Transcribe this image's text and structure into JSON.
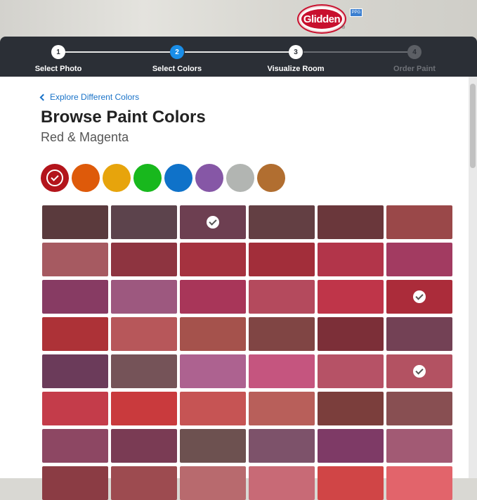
{
  "brand": {
    "logo_text": "Glidden",
    "badge": "PPG"
  },
  "steps": [
    {
      "number": "1",
      "label": "Select Photo",
      "state": "done"
    },
    {
      "number": "2",
      "label": "Select Colors",
      "state": "active"
    },
    {
      "number": "3",
      "label": "Visualize Room",
      "state": "done"
    },
    {
      "number": "4",
      "label": "Order Paint",
      "state": "disabled"
    }
  ],
  "main": {
    "back_link": "Explore Different Colors",
    "title": "Browse Paint Colors",
    "subtitle": "Red & Magenta"
  },
  "color_families": [
    {
      "name": "red",
      "color": "#b3141b",
      "selected": true
    },
    {
      "name": "orange",
      "color": "#de5a0a",
      "selected": false
    },
    {
      "name": "yellow",
      "color": "#e7a40c",
      "selected": false
    },
    {
      "name": "green",
      "color": "#18b81d",
      "selected": false
    },
    {
      "name": "blue",
      "color": "#0f72c9",
      "selected": false
    },
    {
      "name": "purple",
      "color": "#8657a6",
      "selected": false
    },
    {
      "name": "gray",
      "color": "#b2b5b2",
      "selected": false
    },
    {
      "name": "brown",
      "color": "#b16e30",
      "selected": false
    }
  ],
  "swatches": [
    {
      "color": "#5a3a3d",
      "selected": false
    },
    {
      "color": "#5c434c",
      "selected": false
    },
    {
      "color": "#6d3f51",
      "selected": true
    },
    {
      "color": "#633f43",
      "selected": false
    },
    {
      "color": "#6a373b",
      "selected": false
    },
    {
      "color": "#9a4849",
      "selected": false
    },
    {
      "color": "#a65a61",
      "selected": false
    },
    {
      "color": "#8e3440",
      "selected": false
    },
    {
      "color": "#a5323f",
      "selected": false
    },
    {
      "color": "#a22e3a",
      "selected": false
    },
    {
      "color": "#b2354a",
      "selected": false
    },
    {
      "color": "#a23b61",
      "selected": false
    },
    {
      "color": "#873b63",
      "selected": false
    },
    {
      "color": "#9d587f",
      "selected": false
    },
    {
      "color": "#a83659",
      "selected": false
    },
    {
      "color": "#b44a5d",
      "selected": false
    },
    {
      "color": "#bf3549",
      "selected": false
    },
    {
      "color": "#ab2c3a",
      "selected": true
    },
    {
      "color": "#ad3237",
      "selected": false
    },
    {
      "color": "#b7575a",
      "selected": false
    },
    {
      "color": "#a5524c",
      "selected": false
    },
    {
      "color": "#804544",
      "selected": false
    },
    {
      "color": "#7c2f38",
      "selected": false
    },
    {
      "color": "#734155",
      "selected": false
    },
    {
      "color": "#6b3b5a",
      "selected": false
    },
    {
      "color": "#755358",
      "selected": false
    },
    {
      "color": "#ad6290",
      "selected": false
    },
    {
      "color": "#c5557f",
      "selected": false
    },
    {
      "color": "#b65266",
      "selected": false
    },
    {
      "color": "#b35262",
      "selected": true
    },
    {
      "color": "#c43c4a",
      "selected": false
    },
    {
      "color": "#c93a3d",
      "selected": false
    },
    {
      "color": "#c65454",
      "selected": false
    },
    {
      "color": "#b85f5a",
      "selected": false
    },
    {
      "color": "#7b3e3c",
      "selected": false
    },
    {
      "color": "#884f52",
      "selected": false
    },
    {
      "color": "#8d4763",
      "selected": false
    },
    {
      "color": "#7a3b54",
      "selected": false
    },
    {
      "color": "#6d5150",
      "selected": false
    },
    {
      "color": "#7d526a",
      "selected": false
    },
    {
      "color": "#7e3a66",
      "selected": false
    },
    {
      "color": "#a25a74",
      "selected": false
    },
    {
      "color": "#8b3c44",
      "selected": false
    },
    {
      "color": "#9d4b50",
      "selected": false
    },
    {
      "color": "#b86a6e",
      "selected": false
    },
    {
      "color": "#c86a76",
      "selected": false
    },
    {
      "color": "#d04546",
      "selected": false
    },
    {
      "color": "#e2646b",
      "selected": false
    }
  ]
}
